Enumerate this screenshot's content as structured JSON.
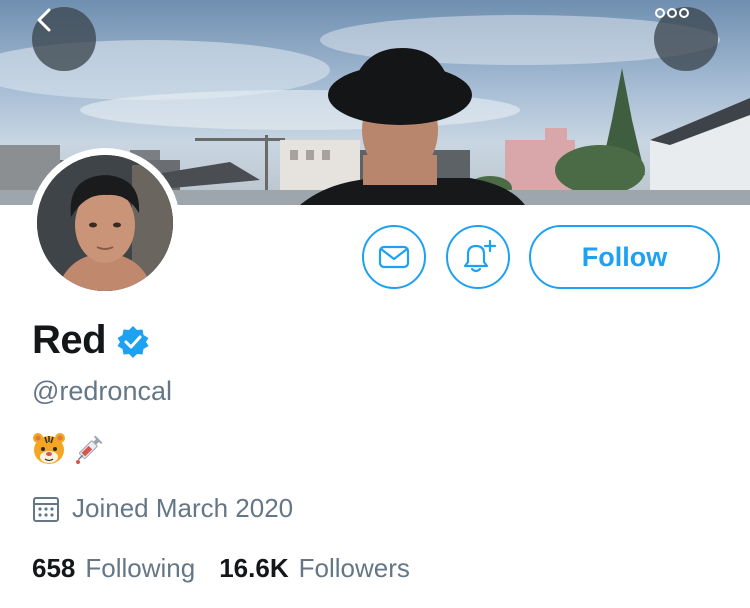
{
  "profile": {
    "display_name": "Red",
    "handle": "@redroncal",
    "joined": "Joined March 2020",
    "verified": true
  },
  "actions": {
    "follow_label": "Follow"
  },
  "stats": {
    "following_count": "658",
    "following_label": "Following",
    "followers_count": "16.6K",
    "followers_label": "Followers"
  },
  "icons": {
    "back": "chevron-left-icon",
    "more": "more-icon",
    "message": "mail-icon",
    "notify": "bell-plus-icon",
    "verified": "verified-badge-icon",
    "calendar": "calendar-icon",
    "bio_1": "tiger-face-emoji",
    "bio_2": "syringe-emoji"
  },
  "colors": {
    "accent": "#1da1f2",
    "text_primary": "#14171a",
    "text_secondary": "#657786"
  }
}
